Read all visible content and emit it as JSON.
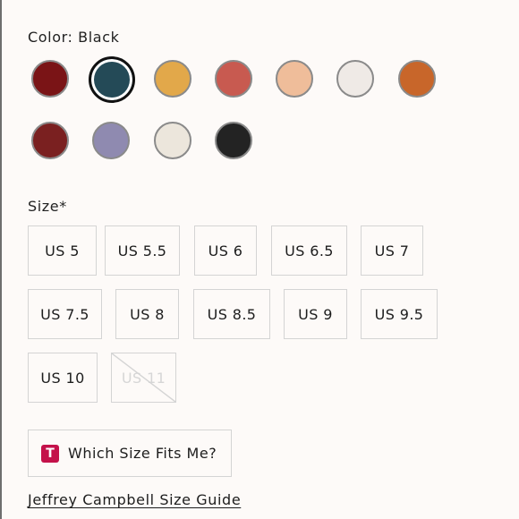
{
  "color_section": {
    "label": "Color: Black",
    "swatches": [
      {
        "color": "#7a1416",
        "name": "swatch-dark-red"
      },
      {
        "color": "#244a57",
        "name": "swatch-teal-black",
        "selected": true
      },
      {
        "color": "#e2a84a",
        "name": "swatch-mustard"
      },
      {
        "color": "#c85a50",
        "name": "swatch-coral-red"
      },
      {
        "color": "#efbd9a",
        "name": "swatch-peach"
      },
      {
        "color": "#efeae6",
        "name": "swatch-white"
      },
      {
        "color": "#c8662a",
        "name": "swatch-rust"
      },
      {
        "color": "#7a2020",
        "name": "swatch-red-buckle"
      },
      {
        "color": "#8f8ab0",
        "name": "swatch-lavender"
      },
      {
        "color": "#ece6dc",
        "name": "swatch-cream"
      },
      {
        "color": "#232323",
        "name": "swatch-black"
      }
    ]
  },
  "size_section": {
    "label": "Size*",
    "sizes": [
      {
        "label": "US 5"
      },
      {
        "label": "US 5.5"
      },
      {
        "label": "US 6"
      },
      {
        "label": "US 6.5"
      },
      {
        "label": "US 7"
      },
      {
        "label": "US 7.5"
      },
      {
        "label": "US 8"
      },
      {
        "label": "US 8.5"
      },
      {
        "label": "US 9"
      },
      {
        "label": "US 9.5"
      },
      {
        "label": "US 10"
      },
      {
        "label": "US 11",
        "disabled": true
      }
    ]
  },
  "fit_button": {
    "icon_letter": "T",
    "label": "Which Size Fits Me?"
  },
  "size_guide_link": "Jeffrey Campbell Size Guide"
}
